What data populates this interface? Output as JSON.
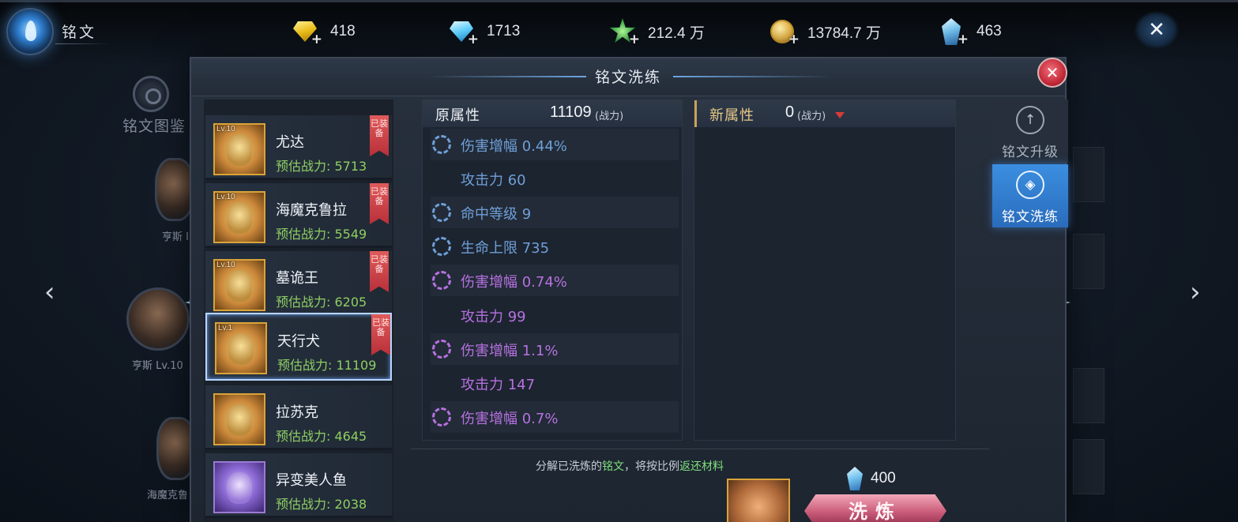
{
  "screen_title": "铭文",
  "resources": [
    {
      "icon": "yellow-diamond-icon",
      "value": "418"
    },
    {
      "icon": "blue-diamond-icon",
      "value": "1713"
    },
    {
      "icon": "green-star-icon",
      "value": "212.4 万"
    },
    {
      "icon": "gold-coin-icon",
      "value": "13784.7 万"
    },
    {
      "icon": "blue-crystal-icon",
      "value": "463"
    }
  ],
  "background": {
    "atlas_label": "铭文图鉴",
    "nodes": [
      "亨斯 I",
      "亨斯 Lv.10",
      "海魔克鲁"
    ]
  },
  "panel": {
    "title": "铭文洗练",
    "inscriptions": [
      {
        "level": "Lv.10",
        "name": "尤达",
        "power": "预估战力: 5713",
        "equipped": "已装备",
        "selected": false
      },
      {
        "level": "Lv.10",
        "name": "海魔克鲁拉",
        "power": "预估战力: 5549",
        "equipped": "已装备",
        "selected": false
      },
      {
        "level": "Lv.10",
        "name": "墓诡王",
        "power": "预估战力: 6205",
        "equipped": "已装备",
        "selected": false
      },
      {
        "level": "Lv.1",
        "name": "天行犬",
        "power": "预估战力: 11109",
        "equipped": "已装备",
        "selected": true
      },
      {
        "level": "",
        "name": "拉苏克",
        "power": "预估战力: 4645",
        "equipped": "",
        "selected": false
      },
      {
        "level": "",
        "name": "异变美人鱼",
        "power": "预估战力: 2038",
        "equipped": "",
        "selected": false
      }
    ],
    "original": {
      "title": "原属性",
      "power": "11109",
      "power_unit": "(战力)",
      "attributes": [
        {
          "text": "伤害增幅 0.44%",
          "color": "blue",
          "icon": true
        },
        {
          "text": "攻击力 60",
          "color": "blue",
          "icon": false
        },
        {
          "text": "命中等级 9",
          "color": "blue",
          "icon": true
        },
        {
          "text": "生命上限 735",
          "color": "blue",
          "icon": true
        },
        {
          "text": "伤害增幅 0.74%",
          "color": "purple",
          "icon": true
        },
        {
          "text": "攻击力 99",
          "color": "purple",
          "icon": false
        },
        {
          "text": "伤害增幅 1.1%",
          "color": "purple",
          "icon": true
        },
        {
          "text": "攻击力 147",
          "color": "purple",
          "icon": false
        },
        {
          "text": "伤害增幅 0.7%",
          "color": "purple",
          "icon": true
        }
      ]
    },
    "new": {
      "title": "新属性",
      "power": "0",
      "power_unit": "(战力)"
    },
    "footer": {
      "note_prefix": "分解已洗炼的",
      "note_highlight1": "铭文",
      "note_middle": "，将按比例",
      "note_highlight2": "返还材料",
      "cost": "400",
      "refine_label": "洗炼"
    },
    "tabs": {
      "upgrade": "铭文升级",
      "refine": "铭文洗练"
    }
  },
  "colors": {
    "attr_blue": "#6f9fd8",
    "attr_purple": "#b671e0",
    "power_green": "#8fcf63",
    "tab_active": "#3b8ee0"
  }
}
